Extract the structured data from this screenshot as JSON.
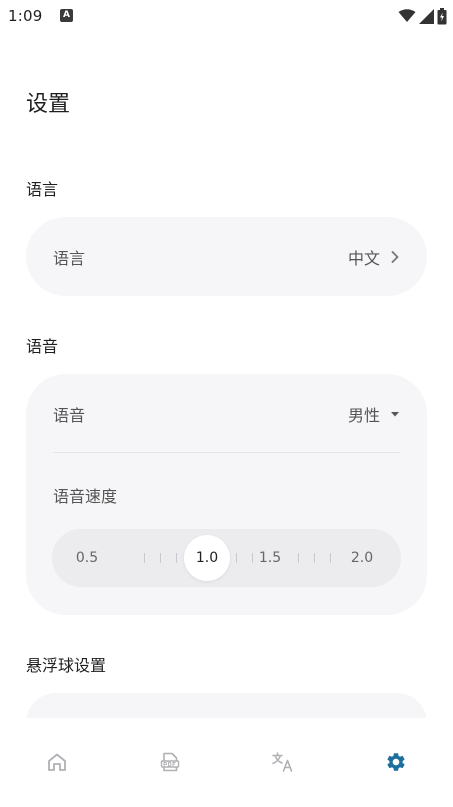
{
  "status_bar": {
    "time": "1:09",
    "notification_icon": "A"
  },
  "page": {
    "title": "设置"
  },
  "sections": {
    "language": {
      "header": "语言",
      "row_label": "语言",
      "row_value": "中文"
    },
    "voice": {
      "header": "语音",
      "voice_label": "语音",
      "voice_value": "男性",
      "speed_label": "语音速度",
      "speed": {
        "min_label": "0.5",
        "current_label": "1.0",
        "mid_label": "1.5",
        "max_label": "2.0",
        "current_value": 1.0
      }
    },
    "floating_ball": {
      "header": "悬浮球设置"
    }
  },
  "bottom_nav": {
    "items": [
      {
        "icon": "home-icon",
        "active": false
      },
      {
        "icon": "pdf-file-icon",
        "active": false
      },
      {
        "icon": "translate-icon",
        "active": false
      },
      {
        "icon": "gear-icon",
        "active": true
      }
    ]
  },
  "colors": {
    "accent": "#1e6f9e",
    "inactive_icon": "#b0b0b5",
    "card_bg": "#f6f6f8"
  }
}
